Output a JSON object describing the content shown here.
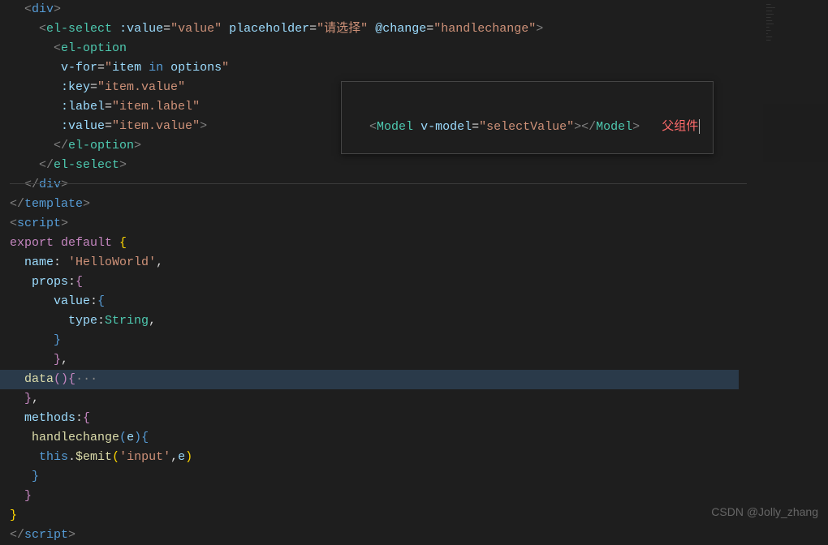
{
  "code": {
    "l1_left": "  ",
    "l1_open": "<",
    "l1_tag": "div",
    "l1_close": ">",
    "l2_indent": "    ",
    "l2_open": "<",
    "l2_tag": "el-select",
    "l2_sp": " ",
    "l2_attr1": ":value",
    "l2_eq": "=",
    "l2_val1": "\"value\"",
    "l2_attr2": "placeholder",
    "l2_val2": "\"请选择\"",
    "l2_attr3": "@change",
    "l2_val3": "\"handlechange\"",
    "l2_close": ">",
    "l3_indent": "      ",
    "l3_open": "<",
    "l3_tag": "el-option",
    "l4_indent": "       ",
    "l4_attr": "v-for",
    "l4_val_open": "\"",
    "l4_item": "item",
    "l4_in": " in ",
    "l4_options": "options",
    "l4_val_close": "\"",
    "l5_attr": ":key",
    "l5_val": "\"item.value\"",
    "l6_attr": ":label",
    "l6_val": "\"item.label\"",
    "l7_attr": ":value",
    "l7_val": "\"item.value\"",
    "l7_close": ">",
    "l8_indent": "      ",
    "l8_open": "</",
    "l8_tag": "el-option",
    "l8_close": ">",
    "l9_indent": "    ",
    "l9_open": "</",
    "l9_tag": "el-select",
    "l9_close": ">",
    "l10_indent": "  ",
    "l10_open": "</",
    "l10_tag": "div",
    "l10_close": ">",
    "l11_open": "</",
    "l11_tag": "template",
    "l11_close": ">",
    "l12_open": "<",
    "l12_tag": "script",
    "l12_close": ">",
    "l13_export": "export",
    "l13_default": " default ",
    "l13_brace": "{",
    "l14_indent": "  ",
    "l14_name": "name",
    "l14_colon": ": ",
    "l14_val": "'HelloWorld'",
    "l14_comma": ",",
    "l15_indent": "   ",
    "l15_props": "props",
    "l15_colon": ":",
    "l15_brace": "{",
    "l16_indent": "      ",
    "l16_value": "value",
    "l16_colon": ":",
    "l16_brace": "{",
    "l17_indent": "        ",
    "l17_type": "type",
    "l17_colon": ":",
    "l17_string": "String",
    "l17_comma": ",",
    "l18_indent": "      ",
    "l18_brace": "}",
    "l19_indent": "      ",
    "l19_brace": "}",
    "l19_comma": ",",
    "l20_indent": "  ",
    "l20_data": "data",
    "l20_parens": "()",
    "l20_brace": "{",
    "l20_fold": "···",
    "l21_indent": "  ",
    "l21_brace": "}",
    "l21_comma": ",",
    "l22_indent": "  ",
    "l22_methods": "methods",
    "l22_colon": ":",
    "l22_brace": "{",
    "l23_indent": "   ",
    "l23_func": "handlechange",
    "l23_paren_open": "(",
    "l23_e": "e",
    "l23_paren_close": ")",
    "l23_brace": "{",
    "l24_indent": "    ",
    "l24_this": "this",
    "l24_dot": ".",
    "l24_emit": "$emit",
    "l24_paren_open": "(",
    "l24_input": "'input'",
    "l24_comma": ",",
    "l24_e": "e",
    "l24_paren_close": ")",
    "l25_indent": "   ",
    "l25_brace": "}",
    "l26_indent": "  ",
    "l26_brace": "}",
    "l27_brace": "}",
    "l28_open": "</",
    "l28_tag": "script",
    "l28_close": ">"
  },
  "tooltip": {
    "open": "<",
    "tag": "Model",
    "sp": " ",
    "attr": "v-model",
    "eq": "=",
    "val": "\"selectValue\"",
    "close1": ">",
    "open2": "</",
    "close2": ">",
    "spacer": "   ",
    "comment": "父组件"
  },
  "watermark": "CSDN @Jolly_zhang"
}
